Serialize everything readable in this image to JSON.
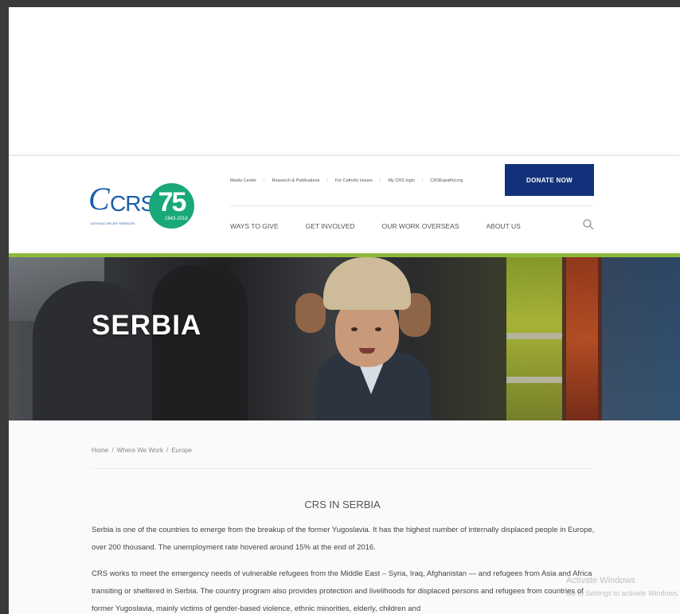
{
  "header": {
    "logo": {
      "brand": "CRS",
      "tagline": "CATHOLIC RELIEF SERVICES",
      "anniversary_number": "75",
      "anniversary_years": "1943-2018"
    },
    "utility_links": [
      "Media Center",
      "Research & Publications",
      "For Catholic Issues",
      "My CRS login",
      "CRSEspañol.org"
    ],
    "donate_label": "DONATE NOW",
    "nav": [
      "WAYS TO GIVE",
      "GET INVOLVED",
      "OUR WORK OVERSEAS",
      "ABOUT US"
    ],
    "search_icon": "search-icon"
  },
  "hero": {
    "title": "SERBIA"
  },
  "breadcrumb": [
    "Home",
    "/",
    "Where We Work",
    "/",
    "Europe"
  ],
  "content": {
    "section_title": "CRS IN SERBIA",
    "paragraph1": "Serbia is one of the countries to emerge from the breakup of the former Yugoslavia. It has the highest number of internally displaced people in Europe, over 200 thousand. The unemployment rate hovered around 15% at the end of 2016.",
    "paragraph2": "CRS works to meet the emergency needs of vulnerable refugees from the Middle East – Syria, Iraq, Afghanistan — and refugees from Asia and Africa transiting or sheltered in Serbia. The country program also provides protection and livelihoods for displaced persons and refugees from countries of former Yugoslavia, mainly victims of gender-based violence, ethnic minorities, elderly, children and"
  },
  "watermark": {
    "line1": "Activate Windows",
    "line2": "Go to Settings to activate Windows."
  },
  "colors": {
    "brand_blue": "#12317a",
    "badge_green": "#19a87a",
    "accent_green": "#8fb83c"
  }
}
